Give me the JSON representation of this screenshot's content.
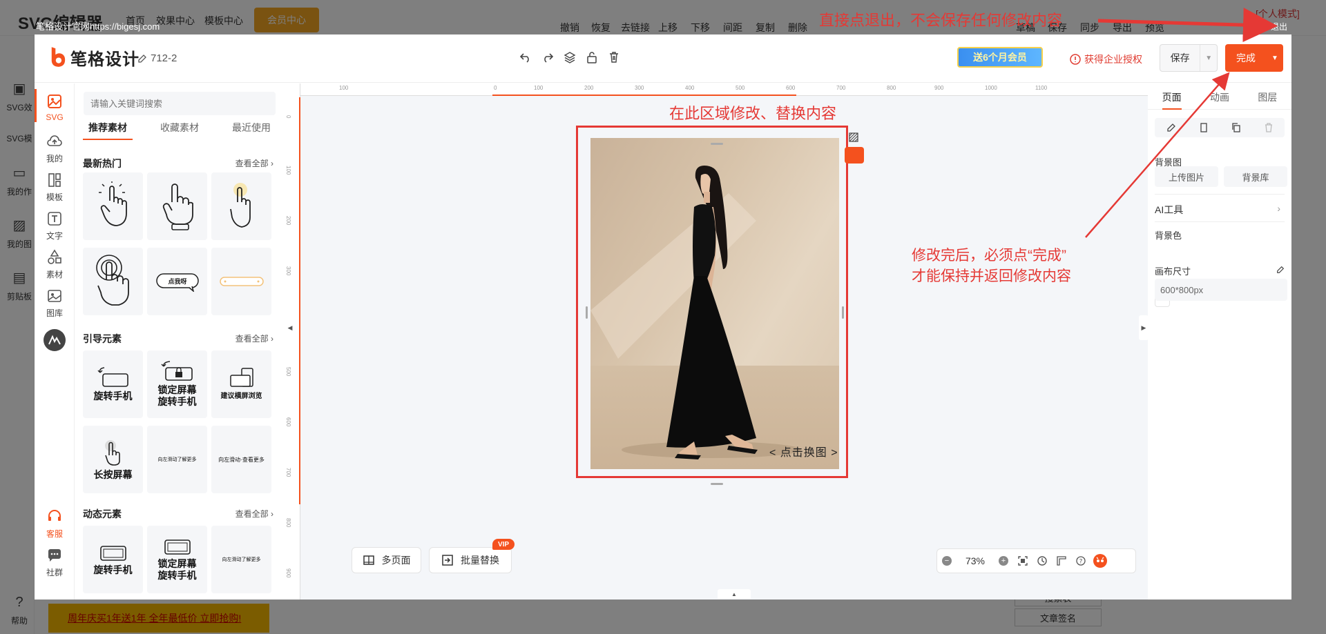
{
  "background_app": {
    "logo": "SVG编辑器",
    "nav": [
      "首页",
      "效果中心",
      "模板中心"
    ],
    "vip_center": "会员中心",
    "toolbar": [
      "撤销",
      "恢复",
      "去链接",
      "上移",
      "下移",
      "间距",
      "复制",
      "删除",
      "草稿",
      "草稿",
      "保存",
      "同步",
      "导出",
      "预览"
    ],
    "personal": "[个人模式]",
    "exit": "退出",
    "watermark": "笔格设计官网https://bigesj.com",
    "sidebar": [
      "SVG效",
      "SVG模",
      "我的作",
      "我的图",
      "剪贴板",
      "帮助"
    ],
    "promo": "周年庆买1年送1年 全年最低价 立即抢购!",
    "right_buttons": [
      "搜索表",
      "文章签名"
    ]
  },
  "header": {
    "logo_text": "笔格设计",
    "doc_name": "712-2",
    "gift_banner": "送6个月会员",
    "license_link": "获得企业授权",
    "save_label": "保存",
    "done_label": "完成"
  },
  "icon_bar": {
    "items": [
      {
        "label": "SVG",
        "icon": "svg-icon"
      },
      {
        "label": "我的",
        "icon": "cloud-icon"
      },
      {
        "label": "模板",
        "icon": "template-icon"
      },
      {
        "label": "文字",
        "icon": "text-icon"
      },
      {
        "label": "素材",
        "icon": "shapes-icon"
      },
      {
        "label": "图库",
        "icon": "image-icon"
      },
      {
        "label": "",
        "icon": "ai-icon"
      },
      {
        "label": "客服",
        "icon": "headset-icon"
      },
      {
        "label": "社群",
        "icon": "chat-icon"
      }
    ]
  },
  "panel": {
    "search_placeholder": "请输入关键词搜索",
    "tabs": [
      "推荐素材",
      "收藏素材",
      "最近使用"
    ],
    "sections": [
      {
        "title": "最新热门",
        "view_all": "查看全部",
        "cards": [
          "",
          "",
          "",
          "",
          "点我呀",
          ""
        ]
      },
      {
        "title": "引导元素",
        "view_all": "查看全部",
        "cards": [
          "旋转手机",
          "锁定屏幕\n旋转手机",
          "建议横屏浏览",
          "长按屏幕",
          "向左滑动了解更多",
          "向左滑动·查看更多"
        ]
      },
      {
        "title": "动态元素",
        "view_all": "查看全部",
        "cards": [
          "旋转手机",
          "锁定屏幕\n旋转手机",
          "向左滑动了解更多"
        ]
      }
    ]
  },
  "canvas": {
    "note": "在此区域修改、替换内容",
    "swap_label": "< 点击换图 >",
    "ruler_h_ticks": [
      "100",
      "0",
      "100",
      "200",
      "300",
      "400",
      "500",
      "600",
      "700",
      "800",
      "900",
      "1000",
      "1100"
    ],
    "ruler_v_ticks": [
      "0",
      "100",
      "200",
      "300",
      "400",
      "500",
      "600",
      "700",
      "800",
      "900"
    ],
    "multi_page": "多页面",
    "batch_replace": "批量替换",
    "vip": "VIP",
    "zoom": "73%"
  },
  "right_panel": {
    "tabs": [
      "页面",
      "动画",
      "图层"
    ],
    "bg_image_label": "背景图",
    "upload_image": "上传图片",
    "bg_library": "背景库",
    "ai_tools": "AI工具",
    "bg_color_label": "背景色",
    "canvas_size_label": "画布尺寸",
    "canvas_size_value": "600*800px"
  },
  "annotations": {
    "top": "直接点退出，不会保存任何修改内容",
    "right_line1": "修改完后，必须点“完成”",
    "right_line2": "才能保持并返回修改内容"
  },
  "colors": {
    "accent": "#f4511e",
    "annotation": "#e53935"
  }
}
